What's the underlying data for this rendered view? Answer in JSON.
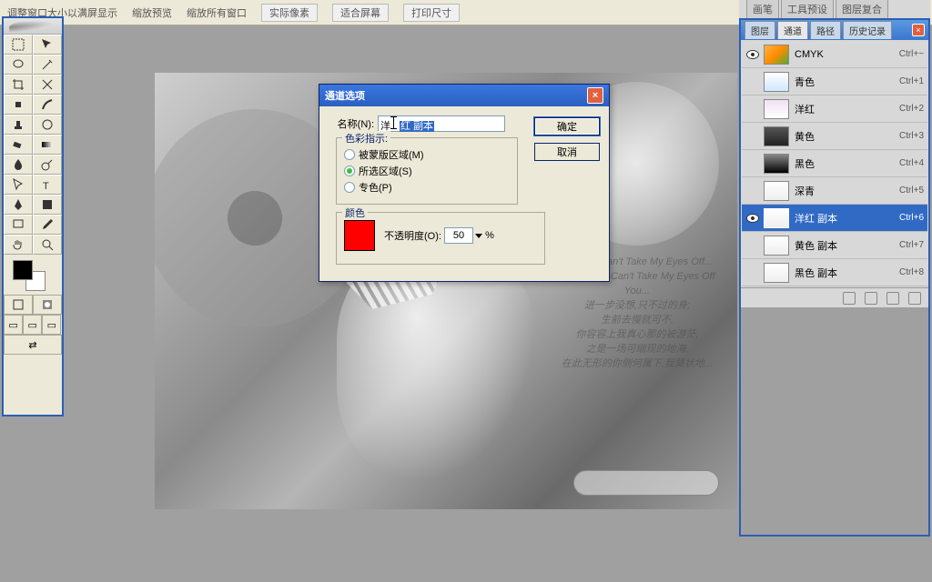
{
  "options_bar": {
    "text1": "调整窗口大小以满屏显示",
    "cb1": "缩放预览",
    "cb2": "缩放所有窗口",
    "btn1": "实际像素",
    "btn2": "适合屏幕",
    "btn3": "打印尺寸"
  },
  "palette_tabs": [
    "画笔",
    "工具预设",
    "图层复合"
  ],
  "dialog": {
    "title": "通道选项",
    "name_label": "名称(N):",
    "name_prefix": "洋",
    "name_selected": "红 副本",
    "ok": "确定",
    "cancel": "取消",
    "group1": "色彩指示:",
    "radio1": "被蒙版区域(M)",
    "radio2": "所选区域(S)",
    "radio3": "专色(P)",
    "group2": "颜色",
    "opacity_label": "不透明度(O):",
    "opacity_value": "50",
    "percent": "%"
  },
  "panel": {
    "tabs": [
      "图层",
      "通道",
      "路径",
      "历史记录"
    ]
  },
  "channels": [
    {
      "eye": true,
      "thumb": "th-cmyk",
      "name": "CMYK",
      "key": "Ctrl+~",
      "sel": false
    },
    {
      "eye": false,
      "thumb": "th-cyan",
      "name": "青色",
      "key": "Ctrl+1",
      "sel": false
    },
    {
      "eye": false,
      "thumb": "th-mag",
      "name": "洋红",
      "key": "Ctrl+2",
      "sel": false
    },
    {
      "eye": false,
      "thumb": "th-yel",
      "name": "黄色",
      "key": "Ctrl+3",
      "sel": false
    },
    {
      "eye": false,
      "thumb": "th-blk",
      "name": "黑色",
      "key": "Ctrl+4",
      "sel": false
    },
    {
      "eye": false,
      "thumb": "th-lt",
      "name": "深青",
      "key": "Ctrl+5",
      "sel": false
    },
    {
      "eye": true,
      "thumb": "th-lt",
      "name": "洋红 副本",
      "key": "Ctrl+6",
      "sel": true
    },
    {
      "eye": false,
      "thumb": "th-lt",
      "name": "黄色 副本",
      "key": "Ctrl+7",
      "sel": false
    },
    {
      "eye": false,
      "thumb": "th-lt",
      "name": "黑色 副本",
      "key": "Ctrl+8",
      "sel": false
    }
  ],
  "poem_lines": [
    "[白日梦]   Can't Take My Eyes Off...",
    "to Be True, Can't Take My Eyes Off You...",
    "进一步没想,只不过的身;",
    "生前去慢就可不,",
    "你容容上我真心那的被游茫,",
    "之是一场可缩现的地海,",
    "在此无形的你侧何属下,我莫状地..."
  ]
}
